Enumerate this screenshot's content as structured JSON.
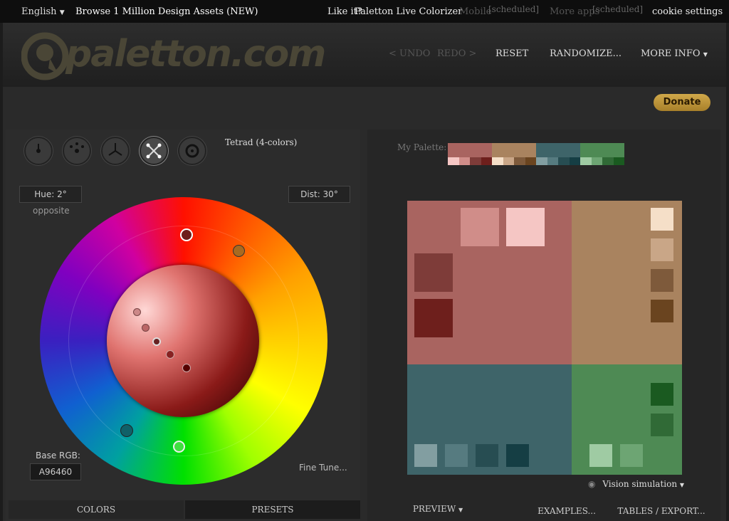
{
  "topbar": {
    "language": "English",
    "browse": "Browse 1 Million Design Assets (NEW)",
    "like_it": "Like it?",
    "colorizer": "Paletton Live Colorizer",
    "mobile": "Mobile",
    "mobile_badge": "[scheduled]",
    "more_apps": "More apps",
    "more_apps_badge": "[scheduled]",
    "cookie": "cookie settings"
  },
  "header": {
    "logo": "paletton.com",
    "undo": "< UNDO",
    "redo": "REDO >",
    "reset": "RESET",
    "randomize": "RANDOMIZE...",
    "more_info": "MORE INFO"
  },
  "donate": "Donate",
  "scheme": {
    "label": "Tetrad (4-colors)"
  },
  "wheel": {
    "hue": "Hue: 2°",
    "hue_mode": "opposite",
    "dist": "Dist: 30°",
    "base_rgb_label": "Base RGB:",
    "base_rgb_value": "A96460",
    "fine_tune": "Fine Tune..."
  },
  "left_tabs": {
    "colors": "COLORS",
    "presets": "PRESETS"
  },
  "palette": {
    "label": "My Palette:",
    "groups": [
      {
        "main": "#a96460",
        "shades": [
          "#f5c6c4",
          "#d08d89",
          "#7e3c39",
          "#6e1f1c"
        ]
      },
      {
        "main": "#a9835f",
        "shades": [
          "#f5dfc8",
          "#c9a687",
          "#7e5a3b",
          "#6a441f"
        ]
      },
      {
        "main": "#3e6469",
        "shades": [
          "#829ea1",
          "#567b80",
          "#274d52",
          "#153e44"
        ]
      },
      {
        "main": "#4e8a54",
        "shades": [
          "#9fcba3",
          "#6da573",
          "#306a36",
          "#1a5a20"
        ]
      }
    ]
  },
  "vision": "Vision simulation",
  "right_tabs": {
    "preview": "PREVIEW",
    "examples": "EXAMPLES...",
    "tables": "TABLES / EXPORT..."
  },
  "icons": {
    "language_caret": "caret-down-icon",
    "eye": "eye-icon"
  }
}
